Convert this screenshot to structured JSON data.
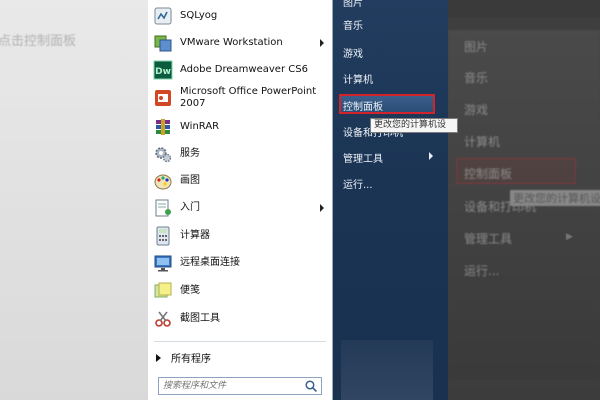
{
  "background": {
    "left_text": "点击控制面板",
    "right_items": [
      "图片",
      "音乐",
      "游戏",
      "计算机",
      "控制面板",
      "设备和打印机",
      "管理工具",
      "运行..."
    ],
    "right_tooltip": "更改您的计算机设"
  },
  "start_menu": {
    "programs": [
      {
        "label": "SQLyog",
        "icon": "sqlyog-icon",
        "arrow": false
      },
      {
        "label": "VMware Workstation",
        "icon": "vmware-icon",
        "arrow": true
      },
      {
        "label": "Adobe Dreamweaver CS6",
        "icon": "dreamweaver-icon",
        "arrow": false
      },
      {
        "label": "Microsoft Office PowerPoint",
        "label2": "2007",
        "icon": "powerpoint-icon",
        "arrow": false
      },
      {
        "label": "WinRAR",
        "icon": "winrar-icon",
        "arrow": false
      },
      {
        "label": "服务",
        "icon": "services-gear-icon",
        "arrow": false
      },
      {
        "label": "画图",
        "icon": "paint-icon",
        "arrow": false
      },
      {
        "label": "入门",
        "icon": "getting-started-icon",
        "arrow": true
      },
      {
        "label": "计算器",
        "icon": "calculator-icon",
        "arrow": false
      },
      {
        "label": "远程桌面连接",
        "icon": "remote-desktop-icon",
        "arrow": false
      },
      {
        "label": "便笺",
        "icon": "sticky-notes-icon",
        "arrow": false
      },
      {
        "label": "截图工具",
        "icon": "snipping-tool-icon",
        "arrow": false
      }
    ],
    "all_programs": "所有程序",
    "search_placeholder": "搜索程序和文件",
    "right_items": [
      "图片",
      "音乐",
      "游戏",
      "计算机",
      "控制面板",
      "设备和打印机",
      "管理工具",
      "运行..."
    ],
    "tooltip": "更改您的计算机设",
    "colors": {
      "highlight_border": "#d2232a",
      "pane_bg": "#1e3a5e"
    }
  }
}
